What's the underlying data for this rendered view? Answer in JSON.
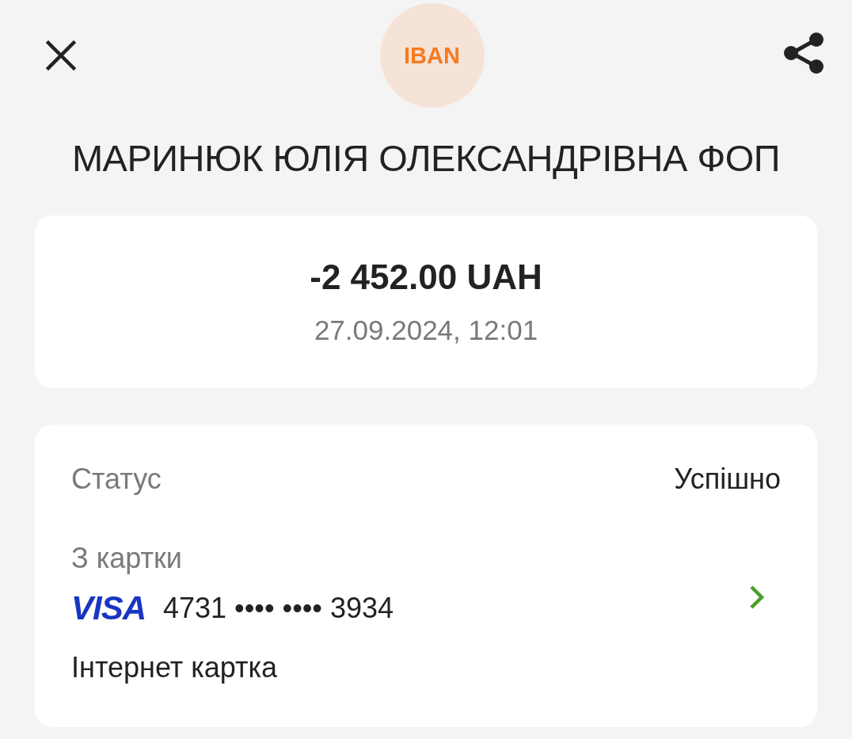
{
  "header": {
    "badge": "IBAN"
  },
  "title": "МАРИНЮК ЮЛІЯ ОЛЕКСАНДРІВНА ФОП",
  "summary": {
    "amount": "-2 452.00 UAH",
    "datetime": "27.09.2024, 12:01"
  },
  "details": {
    "status": {
      "label": "Статус",
      "value": "Успішно"
    },
    "source": {
      "label": "З картки",
      "network": "VISA",
      "card_number": "4731 •••• •••• 3934",
      "card_name": "Інтернет картка"
    }
  }
}
